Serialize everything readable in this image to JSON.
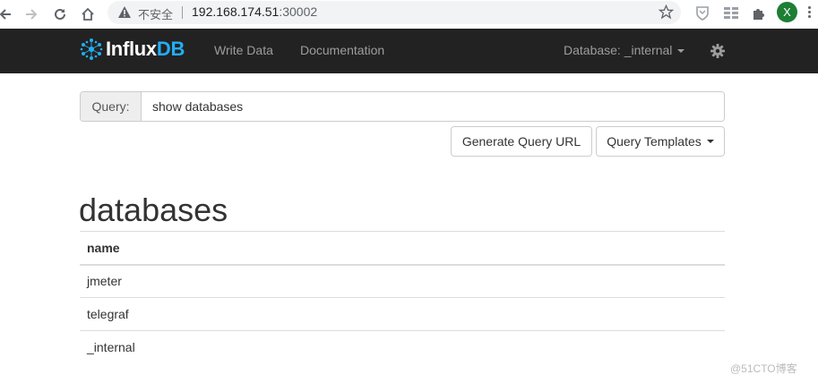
{
  "browser": {
    "security_label": "不安全",
    "url_host": "192.168.174.51",
    "url_port": ":30002",
    "profile_initial": "X"
  },
  "navbar": {
    "brand_part1": "Influx",
    "brand_part2": "DB",
    "write_data": "Write Data",
    "documentation": "Documentation",
    "database_selector": "Database: _internal"
  },
  "query": {
    "label": "Query:",
    "value": "show databases"
  },
  "buttons": {
    "generate_url": "Generate Query URL",
    "templates": "Query Templates"
  },
  "results": {
    "title": "databases",
    "column": "name",
    "rows": [
      "jmeter",
      "telegraf",
      "_internal"
    ]
  },
  "watermark": "@51CTO博客",
  "colors": {
    "navbar_bg": "#222222",
    "brand_accent": "#22adf6"
  }
}
